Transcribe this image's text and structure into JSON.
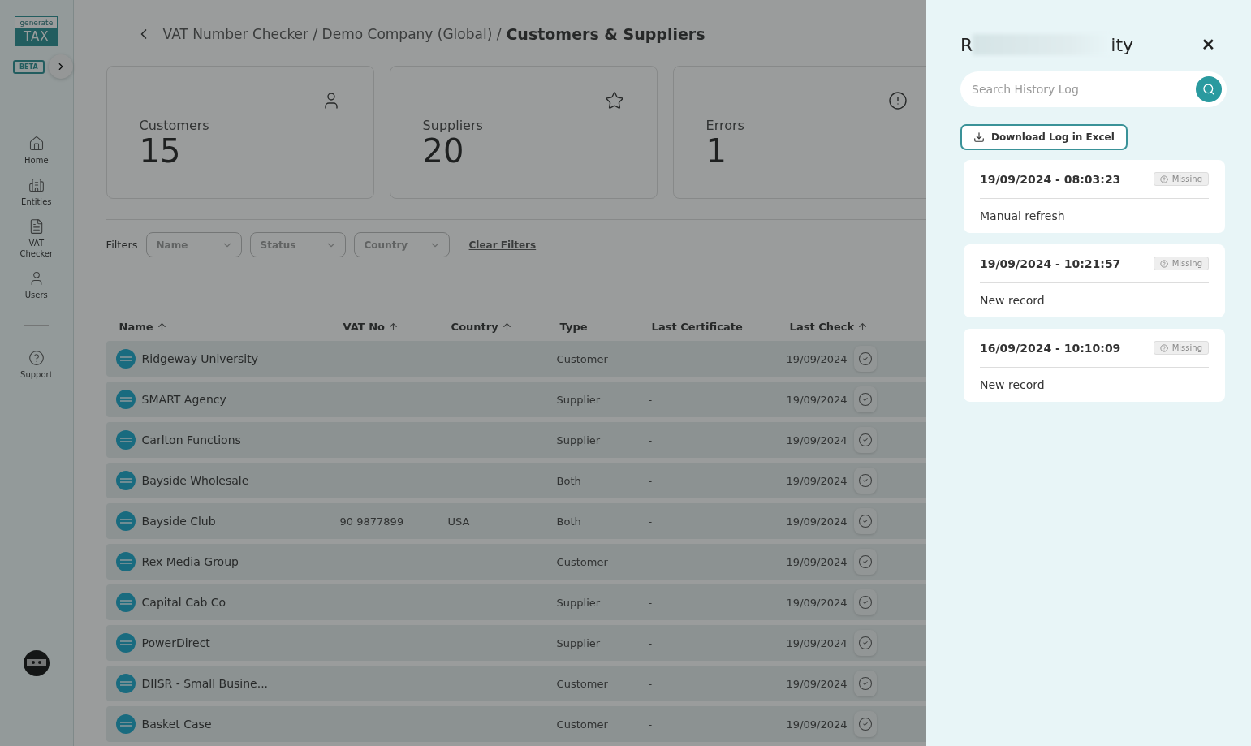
{
  "sidebar": {
    "logo": {
      "top": "generate",
      "bottom": "TAX"
    },
    "badge": "BETA",
    "items": [
      {
        "label": "Home"
      },
      {
        "label": "Entities"
      },
      {
        "label": "VAT Checker"
      },
      {
        "label": "Users"
      }
    ],
    "support": {
      "label": "Support"
    }
  },
  "breadcrumb": {
    "path": "VAT Number Checker / Demo Company (Global) /",
    "current": "Customers & Suppliers"
  },
  "stats": [
    {
      "label": "Customers",
      "value": "15"
    },
    {
      "label": "Suppliers",
      "value": "20"
    },
    {
      "label": "Errors",
      "value": "1"
    }
  ],
  "filters": {
    "label": "Filters",
    "dropdowns": [
      {
        "placeholder": "Name"
      },
      {
        "placeholder": "Status"
      },
      {
        "placeholder": "Country"
      }
    ],
    "clear": "Clear Filters"
  },
  "table": {
    "columns": [
      {
        "label": "Name",
        "sortable": true
      },
      {
        "label": "VAT No",
        "sortable": true
      },
      {
        "label": "Country",
        "sortable": true
      },
      {
        "label": "Type",
        "sortable": false
      },
      {
        "label": "Last Certificate",
        "sortable": false
      },
      {
        "label": "Last Check",
        "sortable": true
      }
    ],
    "rows": [
      {
        "name": "Ridgeway University",
        "vat_no": "",
        "country": "",
        "type": "Customer",
        "last_certificate": "-",
        "last_check": "19/09/2024"
      },
      {
        "name": "SMART Agency",
        "vat_no": "",
        "country": "",
        "type": "Supplier",
        "last_certificate": "-",
        "last_check": "19/09/2024"
      },
      {
        "name": "Carlton Functions",
        "vat_no": "",
        "country": "",
        "type": "Supplier",
        "last_certificate": "-",
        "last_check": "19/09/2024"
      },
      {
        "name": "Bayside Wholesale",
        "vat_no": "",
        "country": "",
        "type": "Both",
        "last_certificate": "-",
        "last_check": "19/09/2024"
      },
      {
        "name": "Bayside Club",
        "vat_no": "90 9877899",
        "country": "USA",
        "type": "Both",
        "last_certificate": "-",
        "last_check": "19/09/2024"
      },
      {
        "name": "Rex Media Group",
        "vat_no": "",
        "country": "",
        "type": "Customer",
        "last_certificate": "-",
        "last_check": "19/09/2024"
      },
      {
        "name": "Capital Cab Co",
        "vat_no": "",
        "country": "",
        "type": "Supplier",
        "last_certificate": "-",
        "last_check": "19/09/2024"
      },
      {
        "name": "PowerDirect",
        "vat_no": "",
        "country": "",
        "type": "Supplier",
        "last_certificate": "-",
        "last_check": "19/09/2024"
      },
      {
        "name": "DIISR - Small Busine...",
        "vat_no": "",
        "country": "",
        "type": "Customer",
        "last_certificate": "-",
        "last_check": "19/09/2024"
      },
      {
        "name": "Basket Case",
        "vat_no": "",
        "country": "",
        "type": "Customer",
        "last_certificate": "-",
        "last_check": "19/09/2024"
      }
    ]
  },
  "panel": {
    "title_start": "R",
    "title_end": "ity",
    "title_redacted": true,
    "close": "✕",
    "search": {
      "placeholder": "Search History Log"
    },
    "download_button": "Download Log in Excel",
    "entries": [
      {
        "timestamp": "19/09/2024 - 08:03:23",
        "status": "Missing",
        "description": "Manual refresh"
      },
      {
        "timestamp": "19/09/2024 - 10:21:57",
        "status": "Missing",
        "description": "New record"
      },
      {
        "timestamp": "16/09/2024 - 10:10:09",
        "status": "Missing",
        "description": "New record"
      }
    ]
  }
}
